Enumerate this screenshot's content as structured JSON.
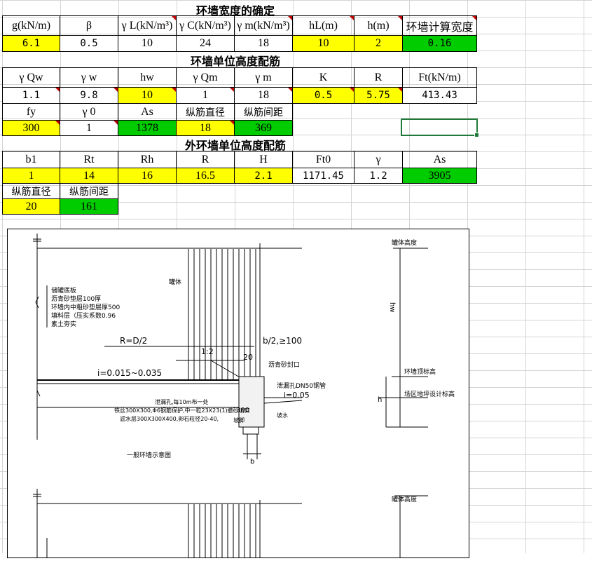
{
  "section1": {
    "title": "环墙宽度的确定",
    "headers": [
      "g(kN/m)",
      "β",
      "γ L(kN/m³)",
      "γ C(kN/m³)",
      "γ m(kN/m³)",
      "hL(m)",
      "h(m)",
      "环墙计算宽度"
    ],
    "values": [
      "6.1",
      "0.5",
      "10",
      "24",
      "18",
      "10",
      "2",
      "0.16"
    ]
  },
  "section2": {
    "title": "环墙单位高度配筋",
    "headers": [
      "γ Qw",
      "γ w",
      "hw",
      "γ Qm",
      "γ m",
      "K",
      "R",
      "Ft(kN/m)"
    ],
    "values": [
      "1.1",
      "9.8",
      "10",
      "1",
      "18",
      "0.5",
      "5.75",
      "413.43"
    ],
    "headers2": [
      "fy",
      "γ 0",
      "As",
      "纵筋直径",
      "纵筋间距"
    ],
    "values2": [
      "300",
      "1",
      "1378",
      "18",
      "369"
    ]
  },
  "section3": {
    "title": "外环墙单位高度配筋",
    "headers": [
      "b1",
      "Rt",
      "Rh",
      "R",
      "H",
      "Ft0",
      "γ",
      "As"
    ],
    "values": [
      "1",
      "14",
      "16",
      "16.5",
      "2.1",
      "1171.45",
      "1.2",
      "3905"
    ],
    "headers2": [
      "纵筋直径",
      "纵筋间距"
    ],
    "values2": [
      "20",
      "161"
    ]
  },
  "drawing": {
    "caption": "一般环墙示意图",
    "labels": {
      "layers": [
        "储罐底板",
        "沥青砂垫层100厚",
        "环墙内中粗砂垫层厚500",
        "填料层（压实系数0.96",
        "素土夯实"
      ],
      "wall": "罐体",
      "r": "R=D/2",
      "b2": "b/2,≥100",
      "slope_ratio": "1:2",
      "s20": "20",
      "slope_i": "i=0.015~0.035",
      "seal": "沥青砂封口",
      "drain": "泄漏孔DN50钢管",
      "i2": "i=0.05",
      "note1": "泄漏孔,每10m布一处",
      "note2": "铁丝300X300,Φ6钢筋保护,中一粒23X23(1)撤砂填实",
      "note3": "滤水层300X300X400,卵石粒径20-40,",
      "n300": "300",
      "hw": "hw",
      "h": "h",
      "b": "b",
      "top_label": "罐体高度",
      "top_label2": "罐体高度",
      "ring_top": "环墙顶标高",
      "ground": "场区地坪设计标高",
      "outer": "坡水",
      "slope": "坡脚"
    }
  }
}
